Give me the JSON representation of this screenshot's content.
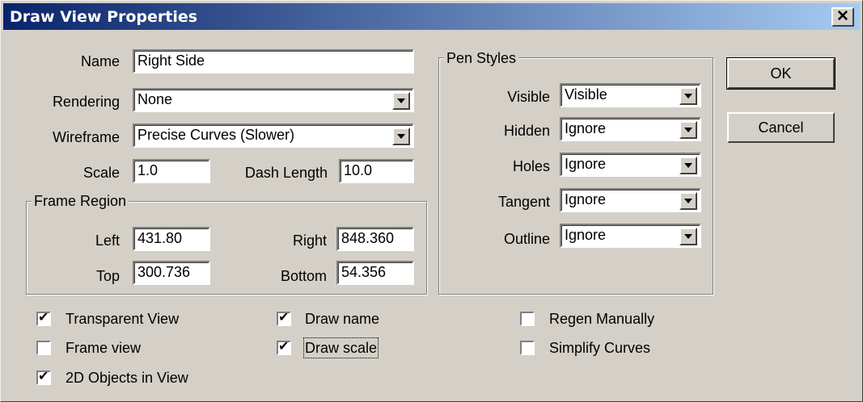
{
  "window": {
    "title": "Draw View Properties",
    "close_label": "✕"
  },
  "fields": {
    "name_label": "Name",
    "name_value": "Right Side",
    "rendering_label": "Rendering",
    "rendering_value": "None",
    "wireframe_label": "Wireframe",
    "wireframe_value": "Precise Curves (Slower)",
    "scale_label": "Scale",
    "scale_value": "1.0",
    "dash_label": "Dash Length",
    "dash_value": "10.0"
  },
  "frame_region": {
    "title": "Frame Region",
    "left_label": "Left",
    "left_value": "431.80",
    "right_label": "Right",
    "right_value": "848.360",
    "top_label": "Top",
    "top_value": "300.736",
    "bottom_label": "Bottom",
    "bottom_value": "54.356"
  },
  "pen_styles": {
    "title": "Pen Styles",
    "rows": [
      {
        "label": "Visible",
        "value": "Visible"
      },
      {
        "label": "Hidden",
        "value": "Ignore"
      },
      {
        "label": "Holes",
        "value": "Ignore"
      },
      {
        "label": "Tangent",
        "value": "Ignore"
      },
      {
        "label": "Outline",
        "value": "Ignore"
      }
    ]
  },
  "buttons": {
    "ok": "OK",
    "cancel": "Cancel"
  },
  "checkboxes": {
    "transparent_view": {
      "label": "Transparent View",
      "checked": true
    },
    "frame_view": {
      "label": "Frame view",
      "checked": false
    },
    "objects_2d": {
      "label": "2D Objects in View",
      "checked": true
    },
    "draw_name": {
      "label": "Draw name",
      "checked": true
    },
    "draw_scale": {
      "label": "Draw scale",
      "checked": true
    },
    "regen_manually": {
      "label": "Regen Manually",
      "checked": false
    },
    "simplify_curves": {
      "label": "Simplify Curves",
      "checked": false
    }
  }
}
